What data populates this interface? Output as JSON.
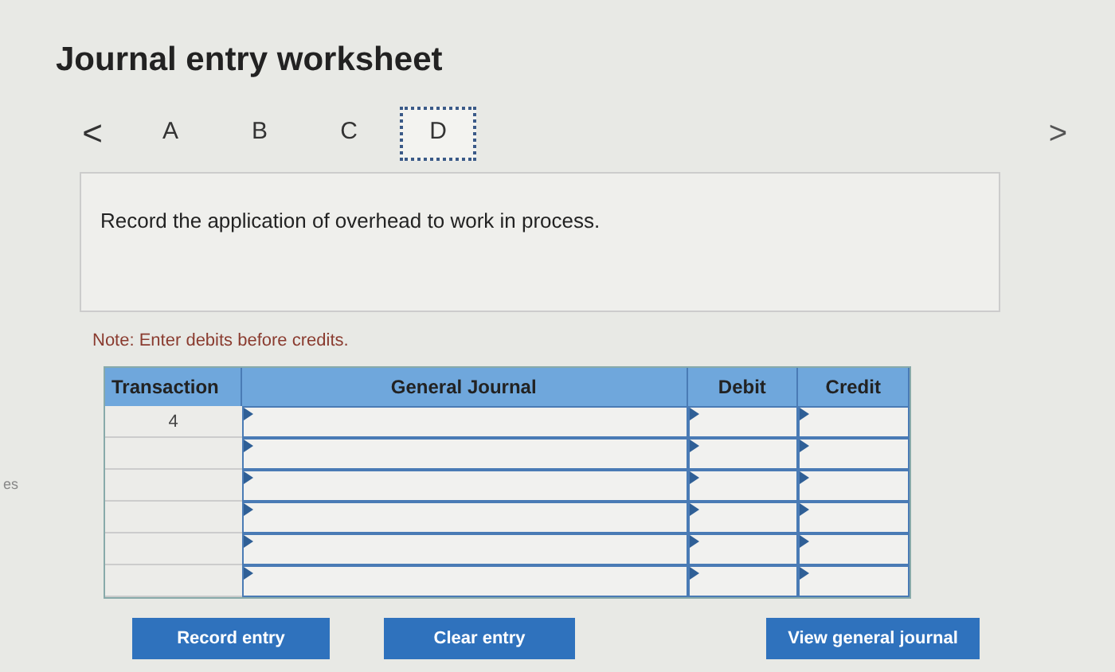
{
  "title": "Journal entry worksheet",
  "nav": {
    "prev": "<",
    "next": ">"
  },
  "tabs": [
    {
      "label": "A",
      "selected": false
    },
    {
      "label": "B",
      "selected": false
    },
    {
      "label": "C",
      "selected": false
    },
    {
      "label": "D",
      "selected": true
    }
  ],
  "prompt": "Record the application of overhead to work in process.",
  "note": "Note: Enter debits before credits.",
  "table": {
    "columns": [
      "Transaction",
      "General Journal",
      "Debit",
      "Credit"
    ],
    "rows": [
      {
        "transaction": "4"
      },
      {
        "transaction": ""
      },
      {
        "transaction": ""
      },
      {
        "transaction": ""
      },
      {
        "transaction": ""
      },
      {
        "transaction": ""
      }
    ]
  },
  "buttons": [
    "Record entry",
    "Clear entry",
    "View general journal"
  ],
  "margin_text": "es"
}
